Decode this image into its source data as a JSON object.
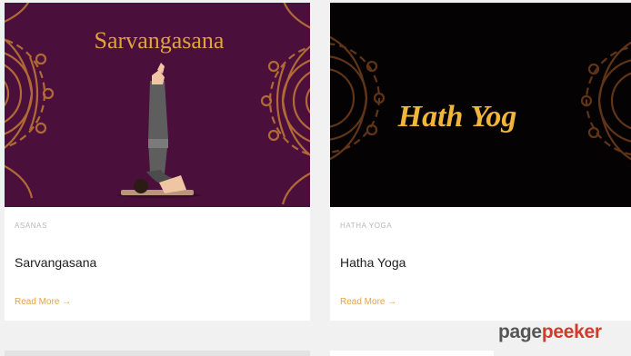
{
  "posts": [
    {
      "image_text": "Sarvangasana",
      "image_colors": {
        "background": "#4b0f3c",
        "title": "#e0a33a",
        "ornament": "#c27b36"
      },
      "category": "ASANAS",
      "title": "Sarvangasana",
      "read_more": "Read More →"
    },
    {
      "image_text": "Hath Yog",
      "image_colors": {
        "background": "#050204",
        "title": "#f1b53a",
        "ornament": "#6a3a1a"
      },
      "category": "HATHA YOGA",
      "title": "Hatha Yoga",
      "read_more": "Read More →"
    }
  ],
  "watermark": {
    "part1": "page",
    "part2": "peeker"
  },
  "colors": {
    "accent": "#e9a23a",
    "page_bg": "#f1f1f1",
    "card_bg": "#ffffff"
  }
}
